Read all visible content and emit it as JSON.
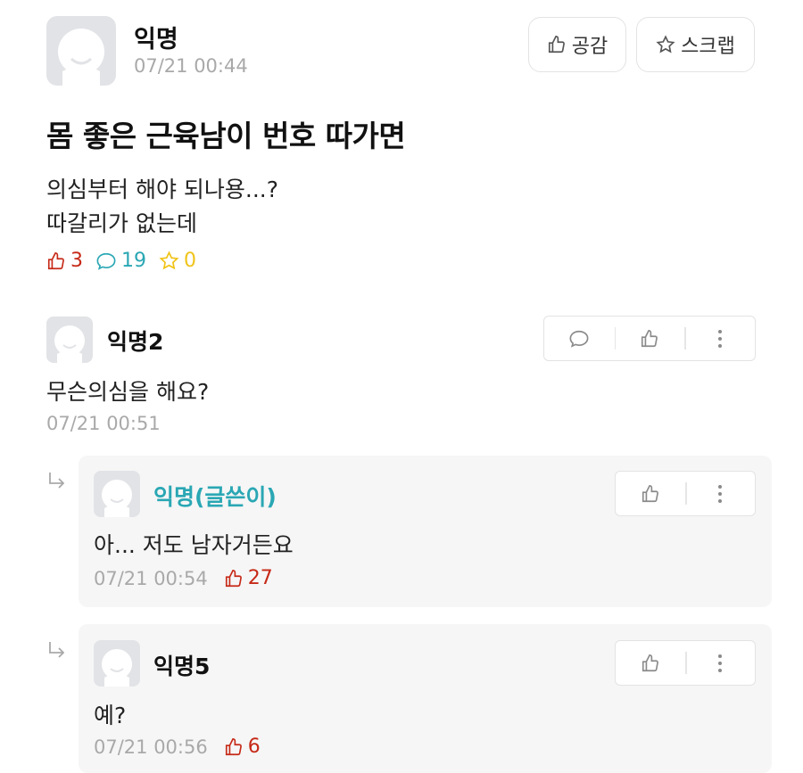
{
  "post": {
    "author": "익명",
    "time": "07/21 00:44",
    "buttons": {
      "like": "공감",
      "scrap": "스크랩"
    },
    "title": "몸 좋은 근육남이 번호 따가면",
    "body_line1": "의심부터 해야 되나용...?",
    "body_line2": "따갈리가 없는데",
    "stats": {
      "likes": "3",
      "comments": "19",
      "scraps": "0"
    }
  },
  "comments": [
    {
      "author": "익명2",
      "text": "무슨의심을 해요?",
      "time": "07/21 00:51"
    }
  ],
  "replies": [
    {
      "author": "익명(글쓴이)",
      "text": "아... 저도 남자거든요",
      "time": "07/21 00:54",
      "likes": "27"
    },
    {
      "author": "익명5",
      "text": "예?",
      "time": "07/21 00:56",
      "likes": "6"
    }
  ],
  "colors": {
    "like_red": "#c62917",
    "comment_teal": "#2aa7b4",
    "scrap_yellow": "#f0c419",
    "writer_teal": "#2aa7b4",
    "meta_gray": "#a9a9a9"
  }
}
